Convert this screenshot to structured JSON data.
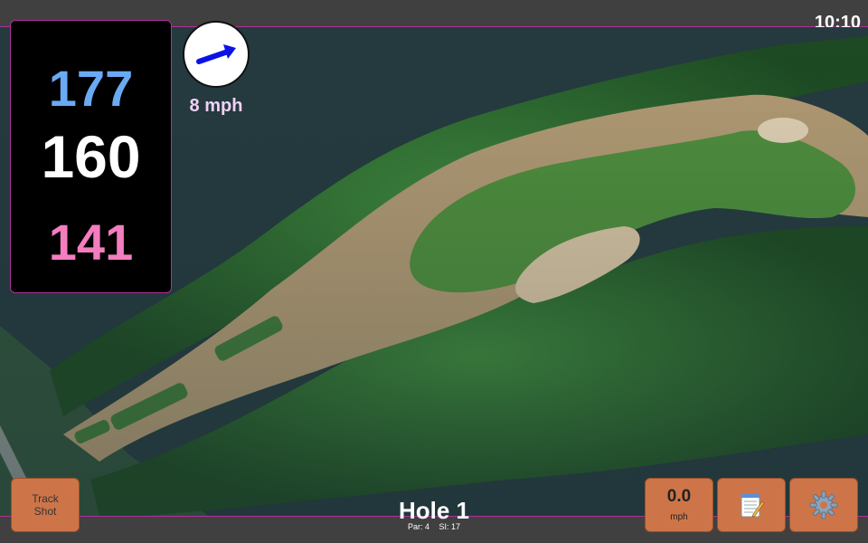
{
  "status": {
    "time": "10:10"
  },
  "distances": {
    "back": "177",
    "center": "160",
    "front": "141"
  },
  "wind": {
    "speed": "8 mph",
    "icon": "wind-arrow-icon"
  },
  "hole": {
    "title": "Hole 1",
    "par": "Par: 4",
    "stroke_index": "SI: 17"
  },
  "buttons": {
    "track_shot": "Track Shot",
    "speed_value": "0.0",
    "speed_unit": "mph",
    "notes_icon": "notepad-icon",
    "settings_icon": "gear-icon"
  },
  "colors": {
    "accent_border": "#b0309a",
    "back_distance": "#6aaaf4",
    "center_distance": "#ffffff",
    "front_distance": "#f47dc0",
    "wind_text": "#f2d0f6",
    "button_fill": "#cd7548"
  }
}
